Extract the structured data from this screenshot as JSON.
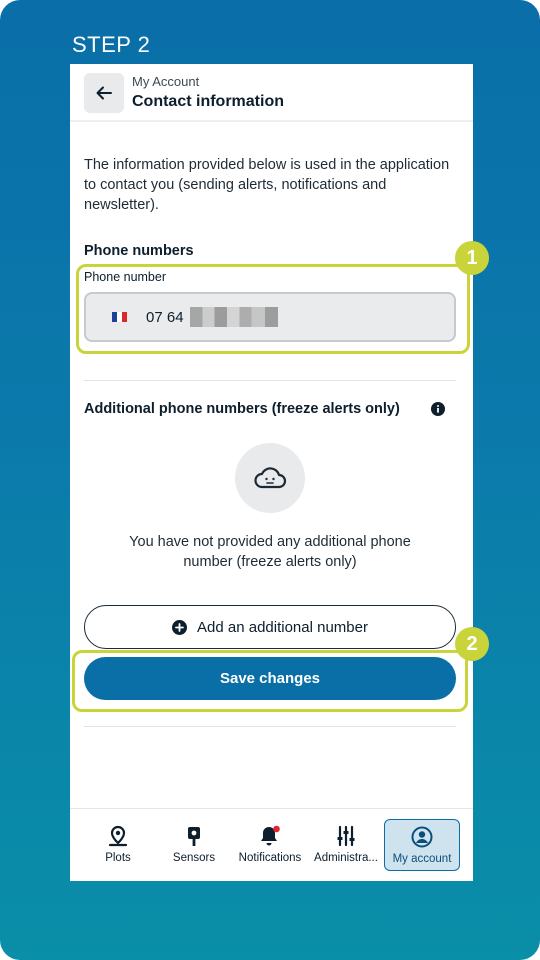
{
  "step_label": "STEP 2",
  "header": {
    "subtitle": "My Account",
    "title": "Contact information"
  },
  "intro_text": "The information provided below is used in the application to contact you (sending alerts, notifications and newsletter).",
  "phone_section": {
    "title": "Phone numbers",
    "field_label": "Phone number",
    "country": "France",
    "value_visible": "07 64"
  },
  "additional_section": {
    "title": "Additional phone numbers (freeze alerts only)",
    "empty_text": "You have not provided any additional phone number (freeze alerts only)",
    "add_button_label": "Add an additional number",
    "save_button_label": "Save changes"
  },
  "tabs": [
    {
      "label": "Plots",
      "icon": "map-pin-icon",
      "active": false
    },
    {
      "label": "Sensors",
      "icon": "sensor-icon",
      "active": false
    },
    {
      "label": "Notifications",
      "icon": "bell-icon",
      "active": false,
      "dot": true
    },
    {
      "label": "Administra...",
      "icon": "sliders-icon",
      "active": false
    },
    {
      "label": "My account",
      "icon": "account-icon",
      "active": true
    }
  ],
  "callouts": [
    "1",
    "2"
  ],
  "colors": {
    "primary": "#0a6fa7",
    "highlight": "#c9d33a",
    "notification_dot": "#e0252b"
  }
}
